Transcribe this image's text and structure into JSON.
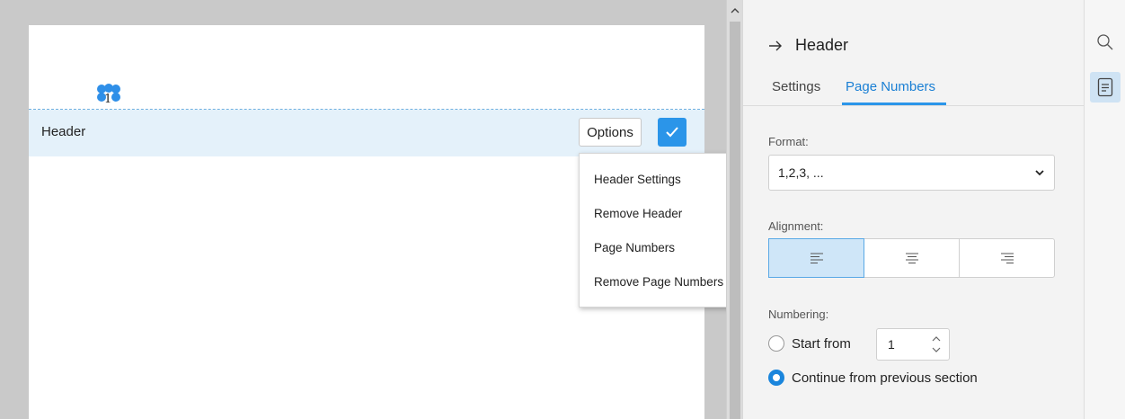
{
  "document": {
    "page_number_marker": "1",
    "header_label": "Header",
    "options_label": "Options"
  },
  "options_menu": {
    "items": [
      "Header Settings",
      "Remove Header",
      "Page Numbers",
      "Remove Page Numbers"
    ]
  },
  "panel": {
    "title": "Header",
    "tabs": [
      "Settings",
      "Page Numbers"
    ],
    "active_tab": "Page Numbers",
    "format_label": "Format:",
    "format_value": "1,2,3, ...",
    "alignment_label": "Alignment:",
    "alignment_selected": "left",
    "numbering_label": "Numbering:",
    "start_from_label": "Start from",
    "start_from_value": "1",
    "continue_label": "Continue from previous section",
    "numbering_selected": "continue"
  },
  "colors": {
    "accent": "#2b95e9",
    "header_band": "#e4f1fa"
  }
}
